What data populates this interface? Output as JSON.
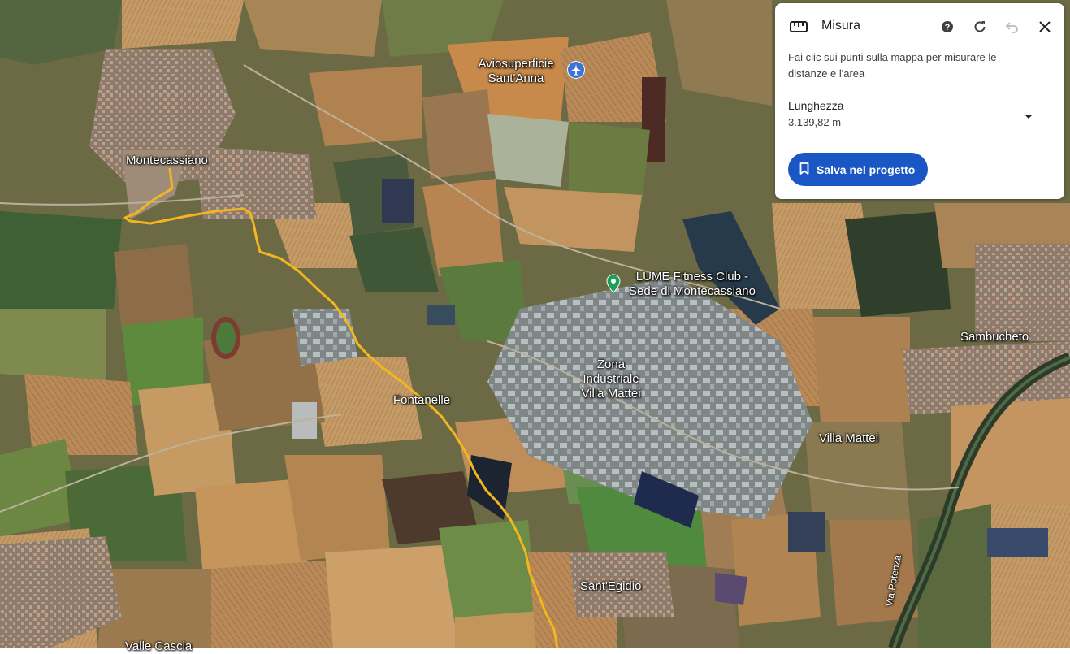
{
  "map": {
    "places": {
      "aviosuperficie": "Aviosuperficie\nSant'Anna",
      "montecassiano": "Montecassiano",
      "lume": "LUME Fitness Club -\nSede di Montecassiano",
      "sambucheto": "Sambucheto",
      "zona": "Zona\nIndustriale\nVilla Mattei",
      "fontanelle": "Fontanelle",
      "villa_mattei": "Villa Mattei",
      "sant_egidio": "Sant'Egidio",
      "valle_cascia": "Valle Cascia",
      "road": "Via Potenza"
    },
    "icons": {
      "airport": "airplane-icon",
      "fitness": "place-pin-icon"
    },
    "route_color": "#f2b61f",
    "airport_pin_color": "#3c74d6",
    "fitness_pin_color": "#1e9e57"
  },
  "panel": {
    "title": "Misura",
    "description": "Fai clic sui punti sulla mappa per misurare le distanze e l'area",
    "length_label": "Lunghezza",
    "length_value": "3.139,82 m",
    "save_label": "Salva nel progetto",
    "icons": {
      "title": "ruler-icon",
      "help": "help-icon",
      "reset": "refresh-icon",
      "undo": "undo-icon",
      "close": "close-icon",
      "dropdown": "caret-down-icon",
      "save": "bookmark-icon"
    },
    "accent_color": "#1a57c4"
  }
}
